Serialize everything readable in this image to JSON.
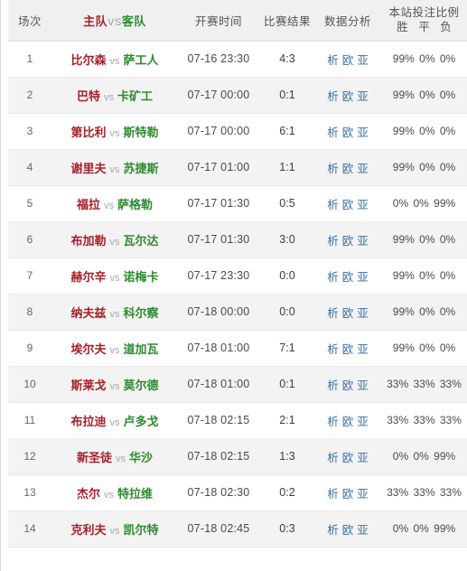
{
  "header": {
    "no_label": "场次",
    "teams": {
      "home_label": "主队",
      "vs_label": "VS",
      "away_label": "客队"
    },
    "time_label": "开赛时间",
    "score_label": "比赛结果",
    "data_label": "数据分析",
    "ratio_label": "本站投注比例",
    "ratio_sub_label": "胜 平 负"
  },
  "colors": {
    "home_team": "#a81f28",
    "away_team": "#2e8b30",
    "link": "#3a6ea5",
    "header_bg": "#f0f0f0",
    "row_alt_bg": "#f3f3f3"
  },
  "data_links": {
    "analysis": "析",
    "europe": "欧",
    "asia": "亚"
  },
  "rows": [
    {
      "no": "1",
      "home": "比尔森",
      "vs": "vs",
      "away": "萨工人",
      "time": "07-16 23:30",
      "score": "4:3",
      "win": "99%",
      "draw": "0%",
      "lose": "0%"
    },
    {
      "no": "2",
      "home": "巴特",
      "vs": "vs",
      "away": "卡矿工",
      "time": "07-17 00:00",
      "score": "0:1",
      "win": "99%",
      "draw": "0%",
      "lose": "0%"
    },
    {
      "no": "3",
      "home": "第比利",
      "vs": "vs",
      "away": "斯特勒",
      "time": "07-17 00:00",
      "score": "6:1",
      "win": "99%",
      "draw": "0%",
      "lose": "0%"
    },
    {
      "no": "4",
      "home": "谢里夫",
      "vs": "vs",
      "away": "苏捷斯",
      "time": "07-17 01:00",
      "score": "1:1",
      "win": "99%",
      "draw": "0%",
      "lose": "0%"
    },
    {
      "no": "5",
      "home": "福拉",
      "vs": "vs",
      "away": "萨格勒",
      "time": "07-17 01:30",
      "score": "0:5",
      "win": "0%",
      "draw": "0%",
      "lose": "99%"
    },
    {
      "no": "6",
      "home": "布加勒",
      "vs": "vs",
      "away": "瓦尔达",
      "time": "07-17 01:30",
      "score": "3:0",
      "win": "99%",
      "draw": "0%",
      "lose": "0%"
    },
    {
      "no": "7",
      "home": "赫尔辛",
      "vs": "vs",
      "away": "诺梅卡",
      "time": "07-17 23:30",
      "score": "0:0",
      "win": "99%",
      "draw": "0%",
      "lose": "0%"
    },
    {
      "no": "8",
      "home": "纳夫兹",
      "vs": "vs",
      "away": "科尔察",
      "time": "07-18 00:00",
      "score": "0:0",
      "win": "99%",
      "draw": "0%",
      "lose": "0%"
    },
    {
      "no": "9",
      "home": "埃尔夫",
      "vs": "vs",
      "away": "道加瓦",
      "time": "07-18 01:00",
      "score": "7:1",
      "win": "99%",
      "draw": "0%",
      "lose": "0%"
    },
    {
      "no": "10",
      "home": "斯莱戈",
      "vs": "vs",
      "away": "莫尔德",
      "time": "07-18 01:00",
      "score": "0:1",
      "win": "33%",
      "draw": "33%",
      "lose": "33%"
    },
    {
      "no": "11",
      "home": "布拉迪",
      "vs": "vs",
      "away": "卢多戈",
      "time": "07-18 02:15",
      "score": "2:1",
      "win": "33%",
      "draw": "33%",
      "lose": "33%"
    },
    {
      "no": "12",
      "home": "新圣徒",
      "vs": "vs",
      "away": "华沙",
      "time": "07-18 02:15",
      "score": "1:3",
      "win": "0%",
      "draw": "0%",
      "lose": "99%"
    },
    {
      "no": "13",
      "home": "杰尔",
      "vs": "vs",
      "away": "特拉维",
      "time": "07-18 02:30",
      "score": "0:2",
      "win": "33%",
      "draw": "33%",
      "lose": "33%"
    },
    {
      "no": "14",
      "home": "克利夫",
      "vs": "vs",
      "away": "凯尔特",
      "time": "07-18 02:45",
      "score": "0:3",
      "win": "0%",
      "draw": "0%",
      "lose": "99%"
    }
  ]
}
